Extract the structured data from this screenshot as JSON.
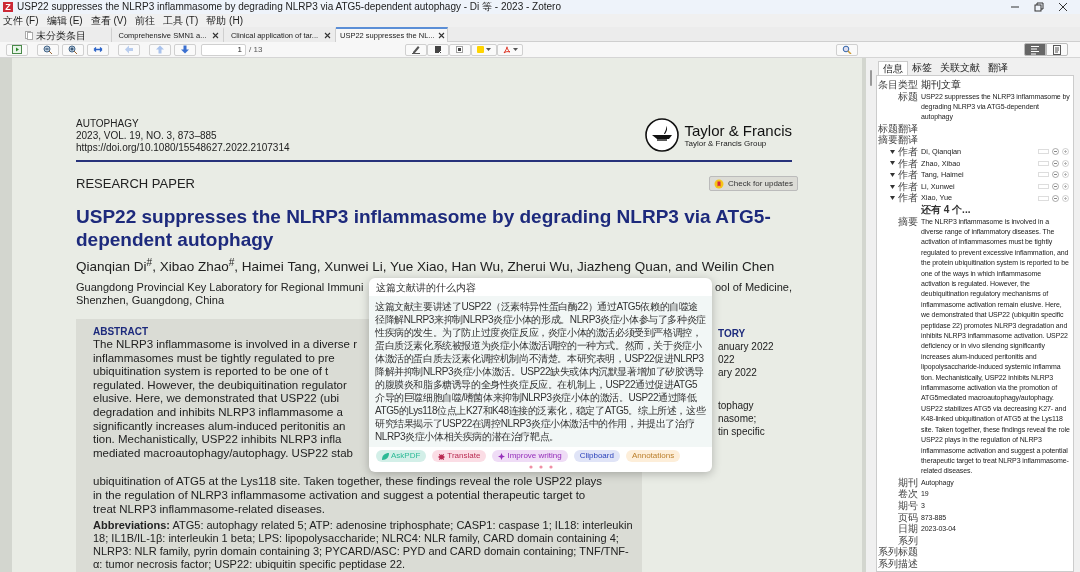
{
  "window": {
    "app_logo": "Z",
    "title": "USP22 suppresses the NLRP3 inflammasome by degrading NLRP3 via ATG5-dependent autophagy - Di 等 - 2023 - Zotero"
  },
  "menu": [
    "文件 (F)",
    "编辑 (E)",
    "查看 (V)",
    "前往",
    "工具 (T)",
    "帮助 (H)"
  ],
  "tabs": [
    {
      "kind": "library",
      "label": "未分类条目",
      "selected": false
    },
    {
      "kind": "reader",
      "label": "Comprehensive SMN1 a...",
      "selected": false
    },
    {
      "kind": "reader",
      "label": "Clinical application of tar...",
      "selected": false
    },
    {
      "kind": "reader",
      "label": "USP22 suppresses the NL...",
      "selected": true
    }
  ],
  "toolbar": {
    "page": "1",
    "page_count": "/ 13"
  },
  "pane_toggles": [
    {
      "kind": "item",
      "selected": true
    },
    {
      "kind": "notes",
      "selected": false
    }
  ],
  "pdf": {
    "journal": "AUTOPHAGY",
    "citation": "2023, VOL. 19, NO. 3, 873–885",
    "doi": "https://doi.org/10.1080/15548627.2022.2107314",
    "publisher": "Taylor & Francis",
    "publisher_group": "Taylor & Francis Group",
    "article_type": "RESEARCH PAPER",
    "update_button": "Check for updates",
    "title": "USP22 suppresses the NLRP3 inflammasome by degrading NLRP3 via ATG5-dependent autophagy",
    "authors": "Qianqian Di$^{#}$, Xibao Zhao$^{#}$, Haimei Tang, Xunwei Li, Yue Xiao, Han Wu, Zherui Wu, Jiazheng Quan, and Weilin Chen",
    "affiliation_left": "Guangdong Provincial Key Laboratory for Regional Immuni",
    "affiliation_right": "ool of Medicine,",
    "affiliation_line_2": "Shenzhen, Guangdong, China",
    "abstract_heading": "ABSTRACT",
    "abstract_partial_lines": [
      "The NLRP3 inflammasome is involved in a diverse r",
      "inflammasomes must be tightly regulated to pre",
      "ubiquitination system is reported to be one of t",
      "regulated. However, the deubiquitination regulator",
      "elusive. Here, we demonstrated that USP22 (ubi",
      "degradation and inhibits NLRP3 inflammasome a",
      "significantly increases alum-induced peritonitis an",
      "tion. Mechanistically, USP22 inhibits NLRP3 infla",
      "mediated macroautophagy/autophagy. USP22 stab"
    ],
    "abstract_lines": [
      "ubiquitination of ATG5 at the Lys118 site. Taken together, these findings reveal the role USP22 plays",
      "in the regulation of NLRP3 inflammasome activation and suggest a potential therapeutic target to",
      "treat NLRP3 inflammasome-related diseases."
    ],
    "history_fragments": [
      "TORY",
      "anuary 2022",
      "022",
      "ary 2022"
    ],
    "keyword_fragments": [
      "tophagy",
      "nasome;",
      "tin specific"
    ],
    "abbreviations": "**Abbreviations:** ATG5: autophagy related 5; ATP: adenosine triphosphate; CASP1: caspase 1; IL18: interleukin 18; IL1B/IL-1β: interleukin 1 beta; LPS: lipopolysaccharide; NLRC4: NLR family, CARD domain containing 4; NLRP3: NLR family, pyrin domain containing 3; PYCARD/ASC: PYD and CARD domain containing; TNF/TNF-α: tumor necrosis factor; USP22: ubiquitin specific peptidase 22."
  },
  "popup": {
    "question": "这篇文献讲的什么内容",
    "answer": "这篇文献主要讲述了USP22（泛素特异性蛋白酶22）通过ATG5依赖的自噬途径降解NLRP3来抑制NLRP3炎症小体的形成。NLRP3炎症小体参与了多种炎症性疾病的发生。为了防止过度炎症反应，炎症小体的激活必须受到严格调控，蛋白质泛素化系统被报道为炎症小体激活调控的一种方式。然而，关于炎症小体激活的蛋白质去泛素化调控机制尚不清楚。本研究表明，USP22促进NLRP3降解并抑制NLRP3炎症小体激活。USP22缺失或体内沉默显著增加了矽胶诱导的腹膜炎和脂多糖诱导的全身性炎症反应。在机制上，USP22通过促进ATG5介导的巨噬细胞自噬/嗜菌体来抑制NLRP3炎症小体的激活。USP22通过降低ATG5的Lys118位点上K27和K48连接的泛素化，稳定了ATG5。综上所述，这些研究结果揭示了USP22在调控NLRP3炎症小体激活中的作用，并提出了治疗NLRP3炎症小体相关疾病的潜在治疗靶点。",
    "actions": [
      {
        "kind": "ask",
        "label": "AskPDF",
        "color": "#d3efe8"
      },
      {
        "kind": "translate",
        "label": "Translate",
        "color": "#fbdde5"
      },
      {
        "kind": "improve",
        "label": "Improve writing",
        "color": "#efdcf6"
      },
      {
        "kind": "clipboard",
        "label": "Clipboard",
        "color": "#e0e4f7"
      },
      {
        "kind": "annotations",
        "label": "Annotations",
        "color": "#fdeed9"
      }
    ]
  },
  "side_tabs": [
    {
      "label": "信息",
      "selected": true
    },
    {
      "label": "标签",
      "selected": false
    },
    {
      "label": "关联文献",
      "selected": false
    },
    {
      "label": "翻译",
      "selected": false
    }
  ],
  "fields": [
    {
      "kind": "item_type",
      "label": "条目类型",
      "value": "期刊文章"
    },
    {
      "kind": "field",
      "label": "标题",
      "value": "USP22 suppresses the NLRP3 inflammasome by degrading NLRP3 via ATG5-dependent autophagy"
    },
    {
      "kind": "field",
      "label": "标题翻译"
    },
    {
      "kind": "field",
      "label": "摘要翻译"
    },
    {
      "kind": "creator",
      "label": "作者",
      "value": "Di, Qianqian"
    },
    {
      "kind": "creator",
      "label": "作者",
      "value": "Zhao, Xibao"
    },
    {
      "kind": "creator",
      "label": "作者",
      "value": "Tang, Haimei"
    },
    {
      "kind": "creator",
      "label": "作者",
      "value": "Li, Xunwei"
    },
    {
      "kind": "creator",
      "label": "作者",
      "value": "Xiao, Yue"
    },
    {
      "kind": "more",
      "value": "还有 4 个..."
    },
    {
      "kind": "field",
      "label": "摘要",
      "value": "The NLRP3 inflammasome is involved in a diverse range of inflammatory diseases. The activation of inflammasomes must be tightly regulated to prevent excessive inflammation, and the protein ubiquitination system is reported to be one of the ways in which inflammasome activation is regulated. However, the deubiquitination regulatory mechanisms of inflammasome activation remain elusive. Here, we demonstrated that USP22 (ubiquitin specific peptidase 22) promotes NLRP3 degradation and inhibits NLRP3 inflammasome activation. USP22 deficiency or in vivo silencing significantly increases alum-induced peritonitis and lipopolysaccharide-induced systemic inflamma tion. Mechanistically, USP22 inhibits NLRP3 inflammasome activation via the promotion of ATG5mediated macroautophagy/autophagy. USP22 stabilizes ATG5 via decreasing K27- and K48-linked ubiquitination of ATG5 at the Lys118 site. Taken together, these findings reveal the role USP22 plays in the regulation of NLRP3 inflammasome activation and suggest a potential therapeutic target to treat NLRP3 inflammasome-related diseases."
    },
    {
      "kind": "field",
      "label": "期刊",
      "value": "Autophagy"
    },
    {
      "kind": "field",
      "label": "卷次",
      "value": "19"
    },
    {
      "kind": "field",
      "label": "期号",
      "value": "3"
    },
    {
      "kind": "field",
      "label": "页码",
      "value": "873-885"
    },
    {
      "kind": "field",
      "label": "日期",
      "value": "2023-03-04"
    },
    {
      "kind": "field",
      "label": "系列"
    },
    {
      "kind": "field",
      "label": "系列标题"
    },
    {
      "kind": "field",
      "label": "系列描述"
    }
  ]
}
